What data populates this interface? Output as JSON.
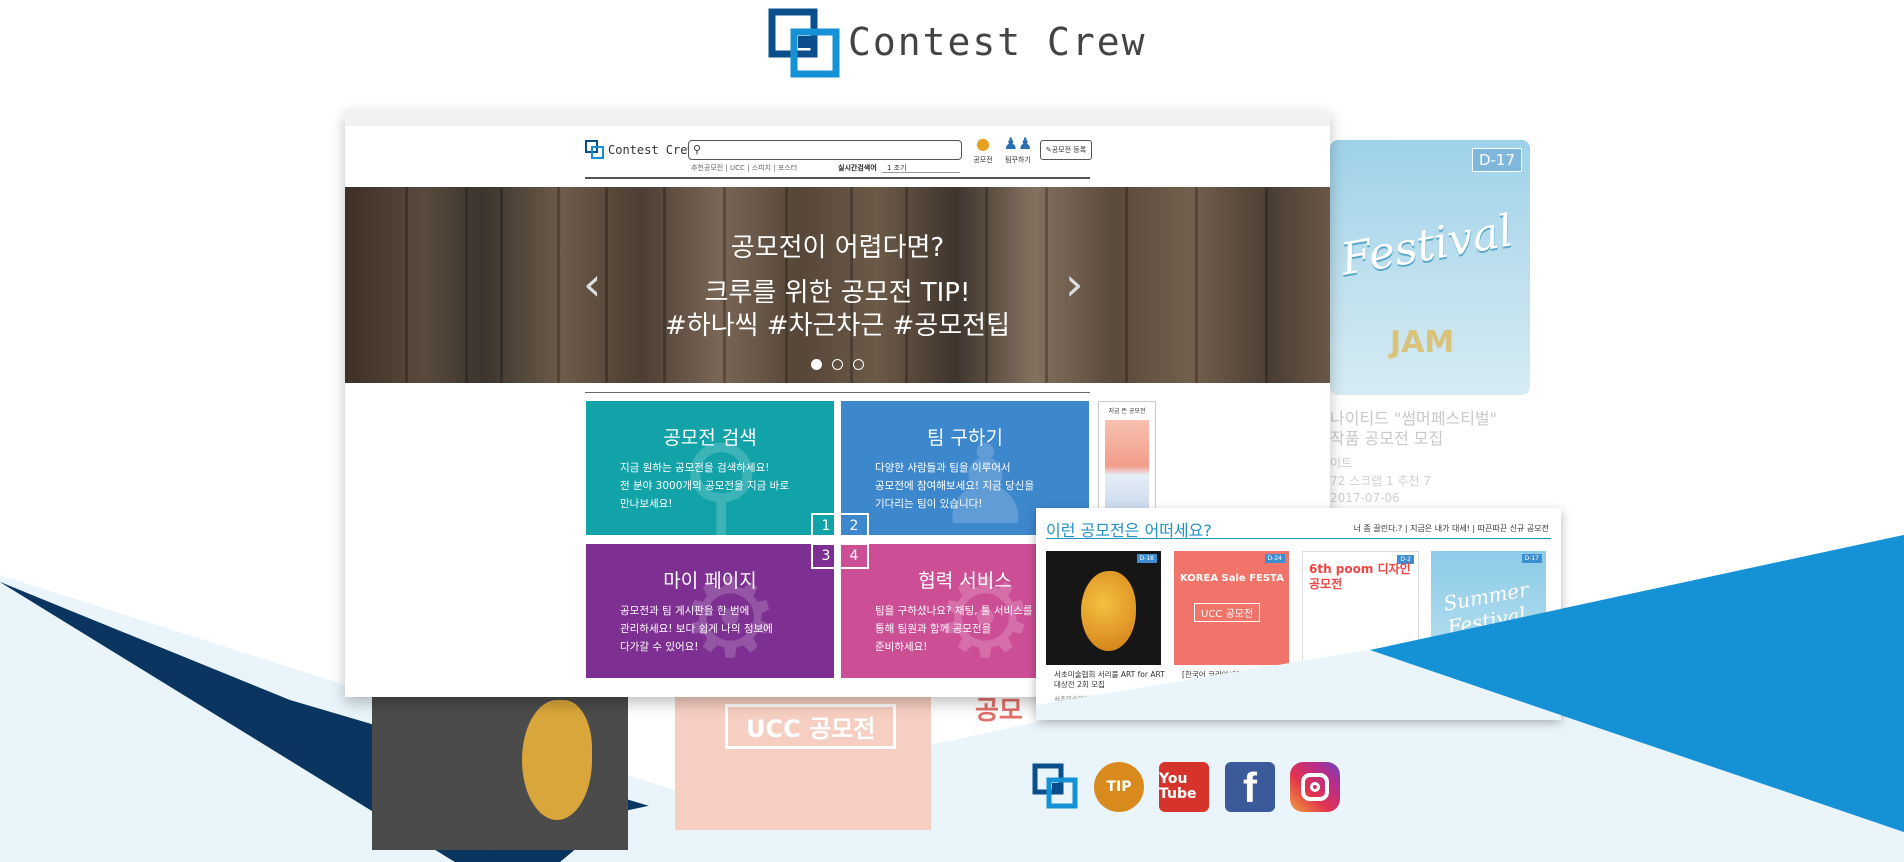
{
  "brand": {
    "name": "Contest Crew"
  },
  "colors": {
    "navy": "#0a3560",
    "blue": "#1592d6",
    "pale": "#e9f5fb",
    "teal": "#12a3a8",
    "tile_blue": "#3d87cd",
    "purple": "#7d3092",
    "pink": "#cc4f96",
    "accent_text": "#2293c5"
  },
  "background_card": {
    "dday": "D-17",
    "title_line1": "나이티드 \"썸머페스티벌\"",
    "title_line2": "작품 공모전 모집",
    "org": "이트",
    "stats": "72    스크랩 1    추천 7",
    "date": "2017-07-06",
    "jam": "JAM"
  },
  "background_posters": {
    "ucc_label": "UCC 공모전",
    "poster3_text": "공모"
  },
  "mockup": {
    "header": {
      "brand": "Contest Crew",
      "search_placeholder": "",
      "keywords": "추천공모전 | UCC | 스피치 | 포스터",
      "realtime_label": "실시간검색어",
      "realtime_value": "1  조기",
      "nav_contest": "공모전",
      "nav_team": "팀꾸하기",
      "register_button": "공모전 등록"
    },
    "hero": {
      "title": "공모전이 어렵다면?",
      "subtitle_line1": "크루를 위한 공모전 TIP!",
      "subtitle_line2": "#하나씩 #차근차근 #공모전팁"
    },
    "tiles": [
      {
        "title": "공모전 검색",
        "desc": [
          "지금 원하는 공모전을 검색하세요!",
          "전 분야 3000개의 공모전을 지금 바로",
          "만나보세요!"
        ]
      },
      {
        "title": "팀 구하기",
        "desc": [
          "다양한 사람들과 팀을 이루어서",
          "공모전에 참여해보세요! 지금 당신을",
          "기다리는 팀이 있습니다!"
        ]
      },
      {
        "title": "마이 페이지",
        "desc": [
          "공모전과 팀 게시판을 한 번에",
          "관리하세요! 보다 쉽게 나의 정보에",
          "다가갈 수 있어요!"
        ]
      },
      {
        "title": "협력 서비스",
        "desc": [
          "팀을 구하셨나요? 채팅, 툴 서비스를",
          "통해 팀원과 함께 공모전을",
          "준비하세요!"
        ]
      }
    ],
    "tile_numbers": [
      "1",
      "2",
      "3",
      "4"
    ],
    "side_banner_label": "지금 뜬 공모전"
  },
  "recommend": {
    "title": "이런 공모전은 어떠세요?",
    "links": "너 좀 끌린다.?  |  지금은 내가 대세!  |  따끈따끈 신규 공모전",
    "cards": [
      {
        "dday": "D-18",
        "caption": "서초미술협회 서리풀 ART for ART 대상전 2회 모집",
        "org": "서초미술협회",
        "stats": "조회수 8063    스크랩 40"
      },
      {
        "dday": "D-24",
        "caption": "[한국어 코리아세일페스타 101배 즐기기 UCC 공모전",
        "head": "KOREA Sale FESTA",
        "label": "UCC 공모전"
      },
      {
        "dday": "D-2",
        "head": "6th poom 디자인 공모전"
      },
      {
        "dday": "D-17",
        "script": "Summer Festival"
      }
    ]
  },
  "social": {
    "tip_label": "TIP",
    "youtube_label": "You Tube",
    "facebook_label": "f"
  }
}
